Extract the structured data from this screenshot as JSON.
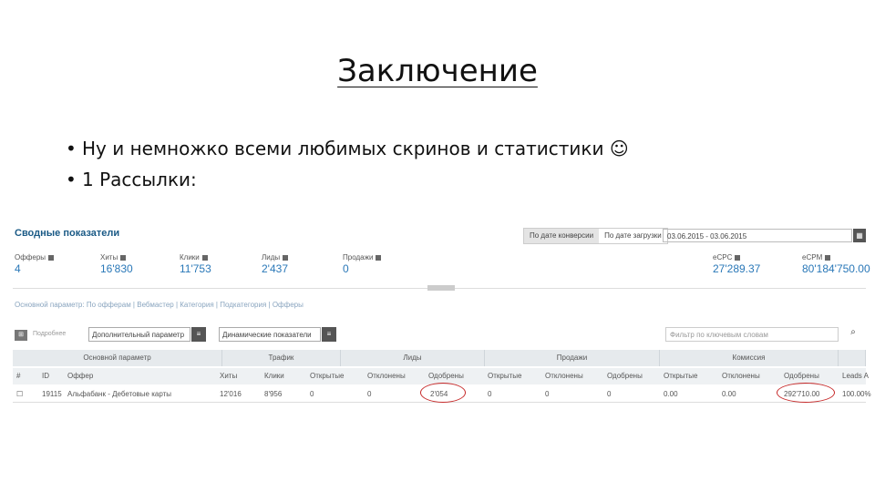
{
  "slide": {
    "title": "Заключение",
    "bullets": [
      "Ну и немножко всеми любимых скринов и статистики ☺",
      "1 Рассылки:"
    ]
  },
  "dashboard": {
    "title": "Сводные показатели",
    "segment": [
      "По дате конверсии",
      "По дате загрузки"
    ],
    "date_range": "03.06.2015 - 03.06.2015",
    "calendar_icon": "calendar-icon",
    "metrics_left": [
      {
        "label": "Офферы",
        "value": "4"
      },
      {
        "label": "Хиты",
        "value": "16'830"
      },
      {
        "label": "Клики",
        "value": "11'753"
      },
      {
        "label": "Лиды",
        "value": "2'437"
      },
      {
        "label": "Продажи",
        "value": "0"
      }
    ],
    "metrics_right": [
      {
        "label": "eCPC",
        "value": "27'289.37"
      },
      {
        "label": "eCPM",
        "value": "80'184'750.00"
      }
    ],
    "breadcrumbs": "Основной параметр: По офферам | Вебмастер | Категория | Подкатегория | Офферы",
    "toolbar": {
      "label": "Подробнее",
      "extra_param": "Дополнительный параметр",
      "dynamic_params": "Динамические показатели",
      "search_placeholder": "Фильтр по ключевым словам"
    },
    "groups": [
      "Основной параметр",
      "Трафик",
      "Лиды",
      "Продажи",
      "Комиссия"
    ],
    "columns": {
      "id": "ID",
      "offer": "Оффер",
      "hits": "Хиты",
      "clicks": "Клики",
      "lead_open": "Открытые",
      "lead_rej": "Отклонены",
      "lead_ok": "Одобрены",
      "sale_open": "Открытые",
      "sale_rej": "Отклонены",
      "sale_ok": "Одобрены",
      "com_open": "Открытые",
      "com_rej": "Отклонены",
      "com_ok": "Одобрены",
      "leads_a": "Leads A"
    },
    "row": {
      "id": "19115",
      "offer": "Альфабанк - Дебетовые карты",
      "hits": "12'016",
      "clicks": "8'956",
      "lead_open": "0",
      "lead_rej": "0",
      "lead_ok": "2'054",
      "sale_open": "0",
      "sale_rej": "0",
      "sale_ok": "0",
      "com_open": "0.00",
      "com_rej": "0.00",
      "com_ok": "292'710.00",
      "leads_a": "100.00%"
    },
    "highlight_color": "#c62828"
  }
}
